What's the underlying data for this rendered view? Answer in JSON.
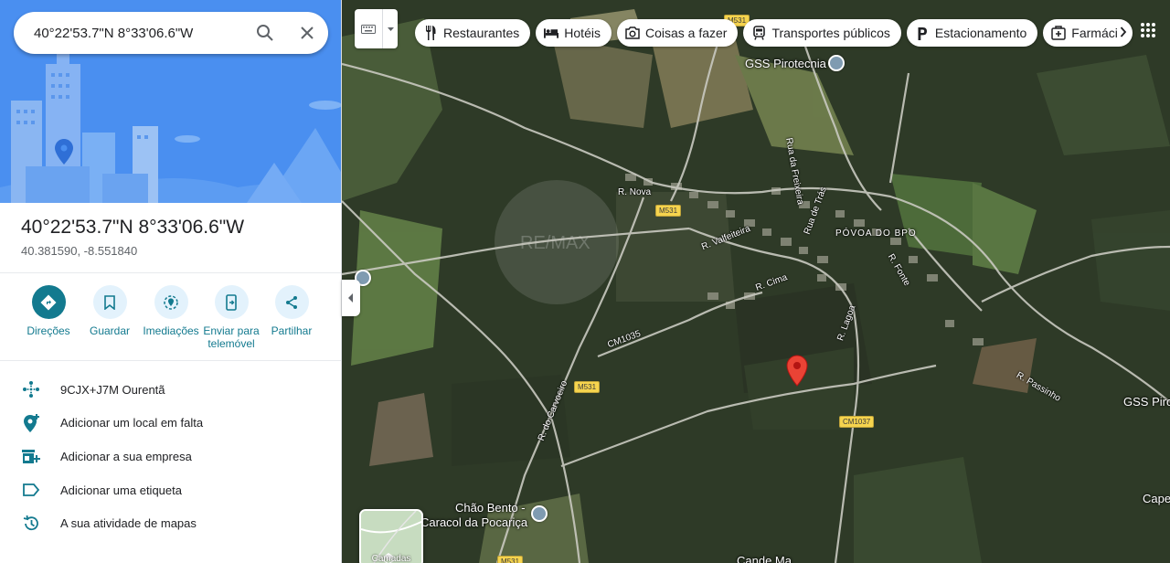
{
  "search": {
    "query": "40°22'53.7\"N 8°33'06.6\"W"
  },
  "place": {
    "title": "40°22'53.7\"N 8°33'06.6\"W",
    "coords": "40.381590, -8.551840"
  },
  "actions": [
    {
      "label": "Direções",
      "icon": "directions-icon"
    },
    {
      "label": "Guardar",
      "icon": "bookmark-icon"
    },
    {
      "label": "Imediações",
      "icon": "nearby-icon"
    },
    {
      "label": "Enviar para telemóvel",
      "icon": "send-to-phone-icon"
    },
    {
      "label": "Partilhar",
      "icon": "share-icon"
    }
  ],
  "info": [
    {
      "text": "9CJX+J7M Ourentã",
      "icon": "plus-code-icon"
    },
    {
      "text": "Adicionar um local em falta",
      "icon": "add-place-icon"
    },
    {
      "text": "Adicionar a sua empresa",
      "icon": "add-business-icon"
    },
    {
      "text": "Adicionar uma etiqueta",
      "icon": "label-icon"
    },
    {
      "text": "A sua atividade de mapas",
      "icon": "history-icon"
    }
  ],
  "chips": [
    {
      "label": "Restaurantes",
      "icon": "fork-knife-icon"
    },
    {
      "label": "Hotéis",
      "icon": "bed-icon"
    },
    {
      "label": "Coisas a fazer",
      "icon": "camera-icon"
    },
    {
      "label": "Transportes públicos",
      "icon": "train-icon"
    },
    {
      "label": "Estacionamento",
      "icon": "parking-icon"
    },
    {
      "label": "Farmáci",
      "icon": "pharmacy-icon"
    }
  ],
  "map": {
    "places": {
      "gss_pirotecnia": "GSS Pirotecnia",
      "gss_piro_right": "GSS Piro",
      "povoa_do_bpo": "PÓVOA DO BPO",
      "chao_bento_1": "Chão Bento -",
      "chao_bento_2": "Caracol da Pocariça",
      "cape": "Cape",
      "bottom_cut": "Cande Ma"
    },
    "roads": {
      "r_nova": "R. Nova",
      "r_valfeiteira": "R. Valfeiteira",
      "r_da_freixeira": "Rua da Freixeira",
      "rua_de_tras": "Rua de Trás",
      "r_fonte": "R. Fonte",
      "r_cima": "R. Cima",
      "r_lagoa": "R. Lagoa",
      "r_passinho": "R. Passinho",
      "r_do_carvoeiro": "R. do Carvoeiro",
      "cm1035": "CM1035"
    },
    "badges": {
      "m531_a": "M531",
      "m531_b": "M531",
      "m531_c": "M531",
      "m531_d": "M531",
      "cm1037": "CM1037"
    },
    "layers_label": "Camadas",
    "watermark": "RE/MAX"
  },
  "colors": {
    "accent": "#137a8f",
    "pin": "#ea4335",
    "hero": "#4a8ff0"
  }
}
